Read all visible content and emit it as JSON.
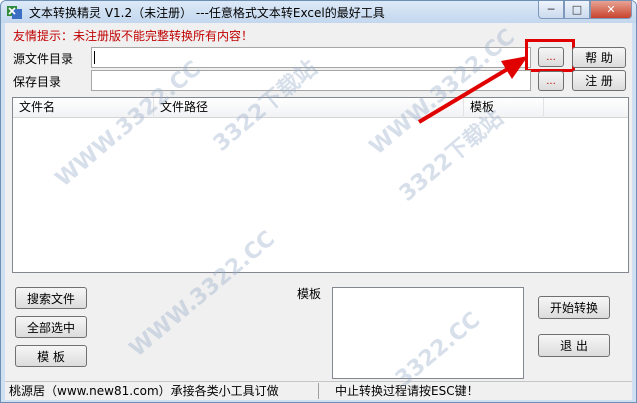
{
  "window": {
    "title": "文本转换精灵 V1.2（未注册）   ---任意格式文本转Excel的最好工具",
    "minimize_glyph": "─",
    "maximize_glyph": "□",
    "close_glyph": "✕"
  },
  "notice": "友情提示：未注册版不能完整转换所有内容！",
  "source": {
    "label": "源文件目录",
    "value": "",
    "browse_label": "...",
    "help_label": "帮 助"
  },
  "save": {
    "label": "保存目录",
    "value": "",
    "browse_label": "...",
    "register_label": "注 册"
  },
  "list": {
    "columns": [
      "文件名",
      "文件路径",
      "模板"
    ]
  },
  "actions": {
    "search_label": "搜索文件",
    "select_all_label": "全部选中",
    "template_label": "模 板"
  },
  "template_area": {
    "label": "模板"
  },
  "convert": {
    "start_label": "开始转换",
    "exit_label": "退 出"
  },
  "status": {
    "left": "桃源居（www.new81.com）承接各类小工具订做",
    "right": "中止转换过程请按ESC键！"
  },
  "watermarks": [
    "WWW.3322.CC",
    "3322下载站",
    "WWW.3322.CC",
    "3322下载站",
    "WWW.3322.CC",
    "3322.CC"
  ],
  "colors": {
    "notice": "#c00000",
    "highlight": "#e00000",
    "arrow": "#e00000"
  }
}
